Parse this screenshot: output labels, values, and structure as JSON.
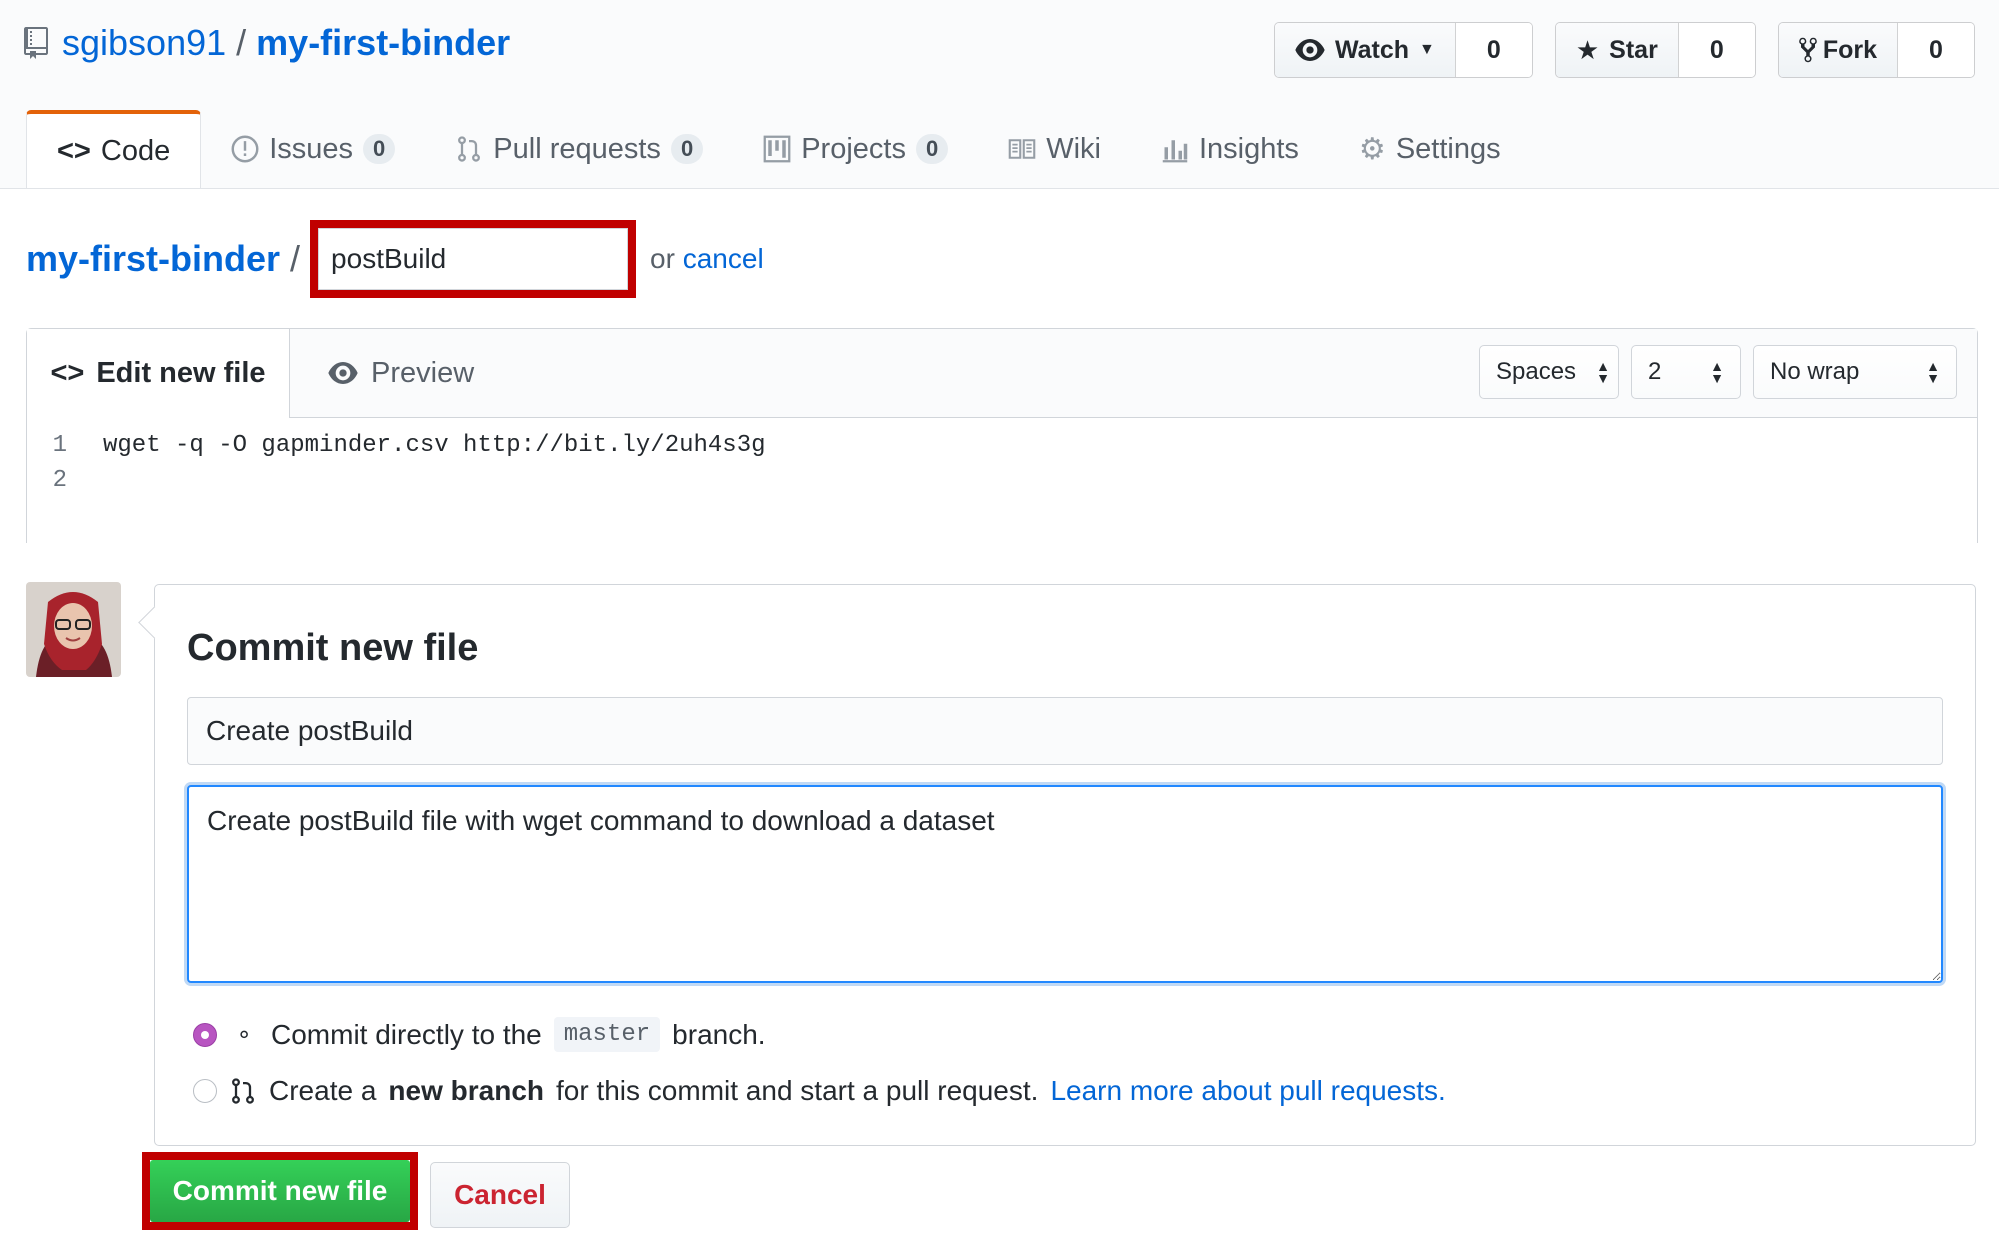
{
  "repo": {
    "owner": "sgibson91",
    "separator": "/",
    "name": "my-first-binder"
  },
  "actions": {
    "watch_label": "Watch",
    "watch_count": "0",
    "star_label": "Star",
    "star_count": "0",
    "fork_label": "Fork",
    "fork_count": "0"
  },
  "tabs": [
    {
      "label": "Code"
    },
    {
      "label": "Issues",
      "count": "0"
    },
    {
      "label": "Pull requests",
      "count": "0"
    },
    {
      "label": "Projects",
      "count": "0"
    },
    {
      "label": "Wiki"
    },
    {
      "label": "Insights"
    },
    {
      "label": "Settings"
    }
  ],
  "path": {
    "crumb": "my-first-binder",
    "separator": "/",
    "filename": "postBuild",
    "or_text": "or",
    "cancel_link": "cancel"
  },
  "editor": {
    "edit_tab": "Edit new file",
    "preview_tab": "Preview",
    "indent_mode": "Spaces",
    "indent_size": "2",
    "wrap_mode": "No wrap",
    "lines": [
      {
        "num": "1",
        "text": "wget -q -O gapminder.csv http://bit.ly/2uh4s3g"
      },
      {
        "num": "2",
        "text": ""
      }
    ]
  },
  "commit": {
    "title": "Commit new file",
    "summary_value": "Create postBuild",
    "description_value": "Create postBuild file with wget command to download a dataset",
    "option_direct_prefix": "Commit directly to the",
    "option_direct_branch": "master",
    "option_direct_suffix": "branch.",
    "option_new_prefix": "Create a",
    "option_new_bold": "new branch",
    "option_new_suffix": "for this commit and start a pull request.",
    "option_new_link": "Learn more about pull requests.",
    "commit_button": "Commit new file",
    "cancel_button": "Cancel"
  },
  "colors": {
    "link": "#0366d6",
    "accent_tab": "#e36209",
    "highlight_box": "#c00000",
    "commit_green": "#28a745",
    "cancel_red": "#cb2431",
    "radio_selected": "#b855c1"
  }
}
